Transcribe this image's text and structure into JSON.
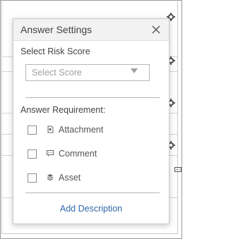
{
  "popover": {
    "title": "Answer Settings",
    "risk_score_label": "Select Risk Score",
    "risk_score_select": {
      "placeholder": "Select Score"
    },
    "requirement_label": "Answer Requirement:",
    "requirements": [
      {
        "label": "Attachment",
        "icon": "attachment-icon",
        "checked": false
      },
      {
        "label": "Comment",
        "icon": "comment-icon",
        "checked": false
      },
      {
        "label": "Asset",
        "icon": "asset-icon",
        "checked": false
      }
    ],
    "add_description_label": "Add Description"
  },
  "colors": {
    "link": "#2e69a8",
    "header_bg": "#f2f2f2",
    "text": "#444444"
  }
}
